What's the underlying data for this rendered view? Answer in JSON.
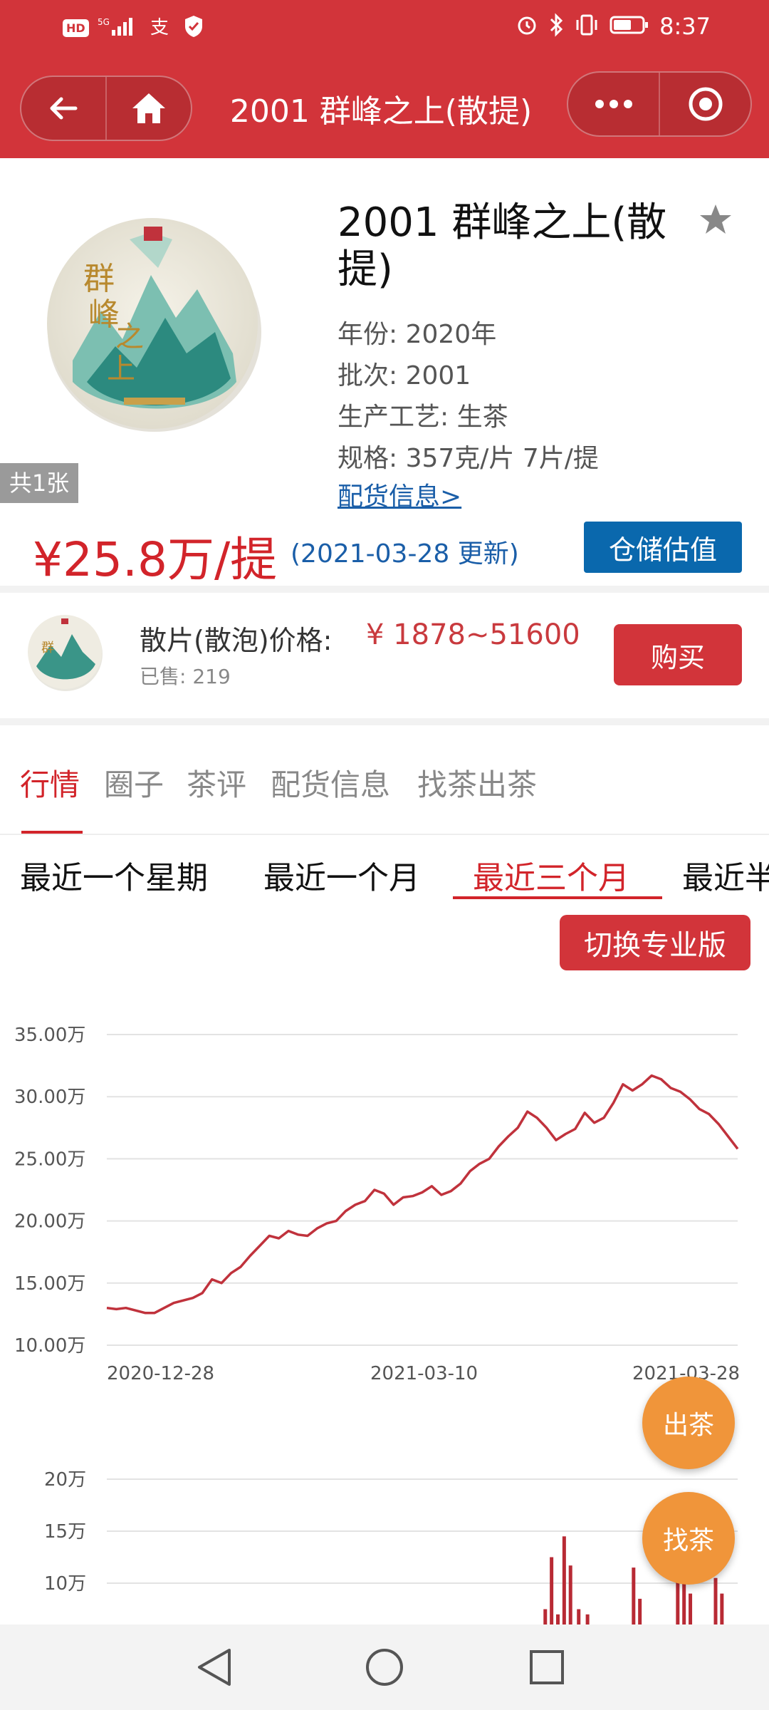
{
  "status_bar": {
    "left_indicators": "HD 5G",
    "time": "8:37"
  },
  "nav": {
    "title": "2001 群峰之上(散提)"
  },
  "product": {
    "title": "2001 群峰之上(散提)",
    "image_count": "共1张",
    "info": [
      "年份: 2020年",
      "批次: 2001",
      "生产工艺: 生茶",
      "规格: 357克/片 7片/提"
    ],
    "alloc_link": "配货信息>",
    "price": "¥25.8万/提",
    "price_update": "(2021-03-28 更新)",
    "warehouse_button": "仓储估值"
  },
  "loose": {
    "label": "散片(散泡)价格:",
    "range": "¥ 1878~51600",
    "sold": "已售: 219",
    "buy_button": "购买"
  },
  "tabs": [
    "行情",
    "圈子",
    "茶评",
    "配货信息",
    "找茶出茶"
  ],
  "periods": [
    "最近一个星期",
    "最近一个月",
    "最近三个月",
    "最近半年"
  ],
  "pro_button": "切换专业版",
  "float": {
    "sell": "出茶",
    "find": "找茶"
  },
  "colors": {
    "brand_red": "#d2343a",
    "price_red": "#d2242a",
    "link_blue": "#1a5ea8",
    "button_blue": "#0a68ad",
    "float_orange": "#f0953a"
  },
  "icons": [
    "back-arrow-icon",
    "home-icon",
    "more-dots-icon",
    "target-circle-icon",
    "star-icon",
    "nav-back-icon",
    "nav-home-icon",
    "nav-recent-icon"
  ],
  "chart_data": [
    {
      "type": "line",
      "x_labels": [
        "2020-12-28",
        "2021-03-10",
        "2021-03-28"
      ],
      "y_ticks": [
        "35.00万",
        "30.00万",
        "25.00万",
        "20.00万",
        "15.00万",
        "10.00万"
      ],
      "ylim": [
        10,
        35
      ],
      "grid": true,
      "series": [
        {
          "color": "#c0323c",
          "values": [
            13.0,
            12.9,
            13.0,
            12.8,
            12.6,
            12.6,
            13.0,
            13.4,
            13.6,
            13.8,
            14.2,
            15.3,
            15.0,
            15.8,
            16.3,
            17.2,
            18.0,
            18.8,
            18.6,
            19.2,
            18.9,
            18.8,
            19.4,
            19.8,
            20.0,
            20.8,
            21.3,
            21.6,
            22.5,
            22.2,
            21.3,
            21.9,
            22.0,
            22.3,
            22.8,
            22.1,
            22.4,
            23.0,
            24.0,
            24.6,
            25.0,
            26.0,
            26.8,
            27.5,
            28.8,
            28.3,
            27.5,
            26.5,
            27.0,
            27.4,
            28.7,
            27.9,
            28.3,
            29.5,
            31.0,
            30.5,
            31.0,
            31.7,
            31.4,
            30.7,
            30.4,
            29.8,
            29.0,
            28.6,
            27.8,
            26.8,
            25.8
          ]
        }
      ]
    },
    {
      "type": "bar",
      "y_ticks": [
        "20万",
        "15万",
        "10万"
      ],
      "ylim": [
        5,
        20
      ],
      "grid": true,
      "bars": [
        {
          "x": 0.695,
          "value": 7.5
        },
        {
          "x": 0.705,
          "value": 12.5
        },
        {
          "x": 0.715,
          "value": 7
        },
        {
          "x": 0.725,
          "value": 14.5
        },
        {
          "x": 0.735,
          "value": 11.7
        },
        {
          "x": 0.748,
          "value": 7.5
        },
        {
          "x": 0.762,
          "value": 7
        },
        {
          "x": 0.835,
          "value": 11.5
        },
        {
          "x": 0.845,
          "value": 8.5
        },
        {
          "x": 0.858,
          "value": 6
        },
        {
          "x": 0.905,
          "value": 12
        },
        {
          "x": 0.915,
          "value": 18
        },
        {
          "x": 0.925,
          "value": 9
        },
        {
          "x": 0.935,
          "value": 6
        },
        {
          "x": 0.965,
          "value": 10.5
        },
        {
          "x": 0.975,
          "value": 9
        },
        {
          "x": 0.985,
          "value": 6
        },
        {
          "x": 0.995,
          "value": 6
        }
      ]
    }
  ]
}
